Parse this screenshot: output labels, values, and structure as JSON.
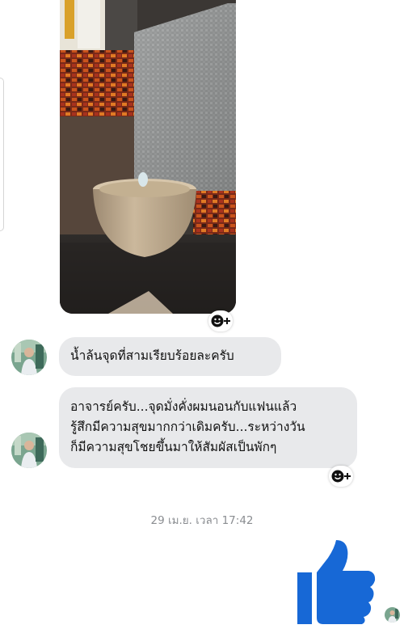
{
  "messages": [
    {
      "type": "image",
      "description_icon": "fountain-photo"
    },
    {
      "type": "text",
      "lines": [
        "น้ำล้นจุดที่สามเรียบร้อยละครับ"
      ]
    },
    {
      "type": "text",
      "lines": [
        "อาจารย์ครับ...จุดมั่งคั่งผมนอนกับแฟนแล้ว",
        "รู้สึกมีความสุขมากกว่าเดิมครับ...ระหว่างวัน",
        "ก็มีความสุขโชยขึ้นมาให้สัมผัสเป็นพักๆ"
      ]
    }
  ],
  "timestamp": "29 เม.ย. เวลา 17:42",
  "icons": {
    "react": "add-reaction-icon",
    "like": "thumbs-up-icon"
  },
  "colors": {
    "bubble": "#e8e9eb",
    "like": "#1877f2",
    "timestamp": "#8a8d91"
  }
}
